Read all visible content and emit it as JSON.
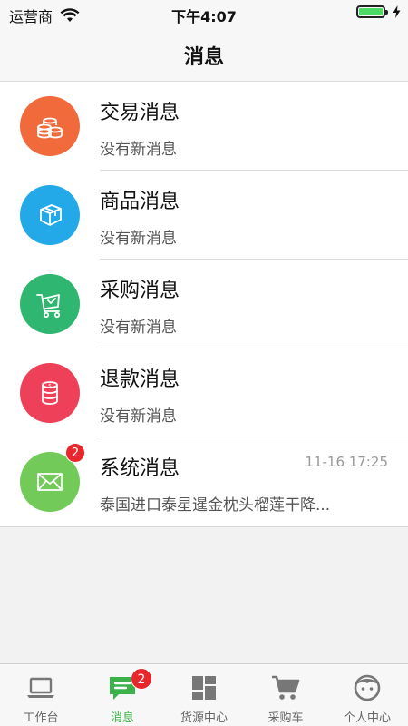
{
  "status_bar": {
    "carrier": "运营商",
    "time": "下午4:07",
    "battery_percent": 100
  },
  "nav": {
    "title": "消息"
  },
  "messages": [
    {
      "title": "交易消息",
      "subtitle": "没有新消息",
      "time": "",
      "badge": "",
      "icon": "coins-icon",
      "color": "#f06a3b"
    },
    {
      "title": "商品消息",
      "subtitle": "没有新消息",
      "time": "",
      "badge": "",
      "icon": "box-icon",
      "color": "#23a9e8"
    },
    {
      "title": "采购消息",
      "subtitle": "没有新消息",
      "time": "",
      "badge": "",
      "icon": "cart-icon",
      "color": "#2fb670"
    },
    {
      "title": "退款消息",
      "subtitle": "没有新消息",
      "time": "",
      "badge": "",
      "icon": "refund-coins-icon",
      "color": "#ee4059"
    },
    {
      "title": "系统消息",
      "subtitle": "泰国进口泰星暹金枕头榴莲干降...",
      "time": "11-16 17:25",
      "badge": "2",
      "icon": "envelope-icon",
      "color": "#72cb58"
    }
  ],
  "tabs": [
    {
      "label": "工作台",
      "icon": "laptop-icon",
      "badge": "",
      "active": false
    },
    {
      "label": "消息",
      "icon": "chat-icon",
      "badge": "2",
      "active": true
    },
    {
      "label": "货源中心",
      "icon": "grid-icon",
      "badge": "",
      "active": false
    },
    {
      "label": "采购车",
      "icon": "shopping-cart-icon",
      "badge": "",
      "active": false
    },
    {
      "label": "个人中心",
      "icon": "face-icon",
      "badge": "",
      "active": false
    }
  ],
  "colors": {
    "accent": "#3bb249",
    "tab_icon": "#777777",
    "badge": "#e8262b"
  }
}
